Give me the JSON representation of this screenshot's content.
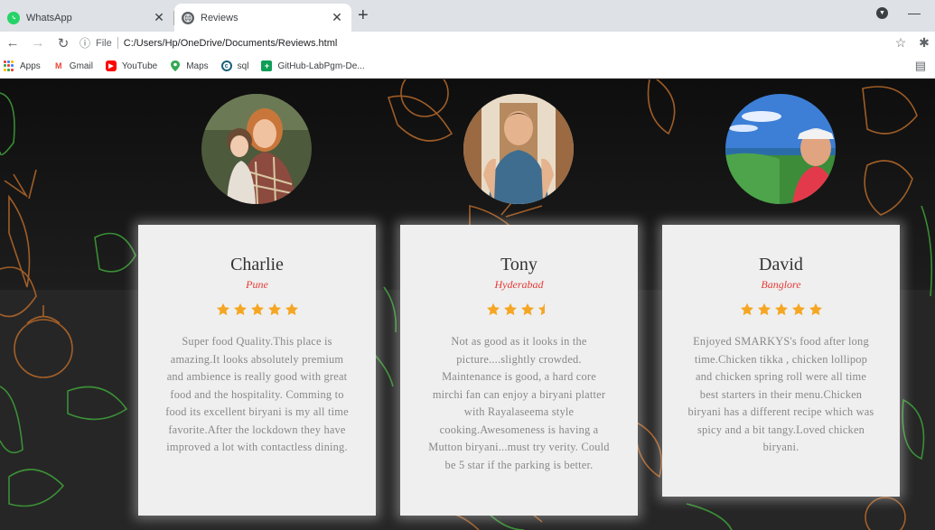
{
  "browser": {
    "tabs": [
      {
        "title": "WhatsApp",
        "icon": "whatsapp-icon",
        "active": false
      },
      {
        "title": "Reviews",
        "icon": "globe-icon",
        "active": true
      }
    ],
    "address": {
      "scheme_label": "File",
      "url": "C:/Users/Hp/OneDrive/Documents/Reviews.html"
    },
    "bookmarks": [
      {
        "label": "Apps",
        "icon": "apps-grid-icon"
      },
      {
        "label": "Gmail",
        "icon": "gmail-icon"
      },
      {
        "label": "YouTube",
        "icon": "youtube-icon"
      },
      {
        "label": "Maps",
        "icon": "maps-pin-icon"
      },
      {
        "label": "sql",
        "icon": "sql-icon"
      },
      {
        "label": "GitHub-LabPgm-De...",
        "icon": "github-labpgm-icon"
      }
    ]
  },
  "reviews": [
    {
      "name": "Charlie",
      "city": "Pune",
      "rating": 5,
      "text": "Super food Quality.This place is amazing.It looks absolutely premium and ambience is really good with great food and the hospitality. Comming to food its excellent biryani is my all time favorite.After the lockdown they have improved a lot with contactless dining."
    },
    {
      "name": "Tony",
      "city": "Hyderabad",
      "rating": 3.5,
      "text": "Not as good as it looks in the picture....slightly crowded. Maintenance is good, a hard core mirchi fan can enjoy a biryani platter with Rayalaseema style cooking.Awesomeness is having a Mutton biryani...must try verity. Could be 5 star if the parking is better."
    },
    {
      "name": "David",
      "city": "Banglore",
      "rating": 5,
      "text": "Enjoyed SMARKYS's food after long time.Chicken tikka , chicken lollipop and chicken spring roll were all time best starters in their menu.Chicken biryani has a different recipe which was spicy and a bit tangy.Loved chicken biryani."
    }
  ],
  "colors": {
    "star": "#f5a623",
    "city": "#e53935",
    "card_bg": "#efefef",
    "review_text": "#888888",
    "sketch_orange": "#b86a2a",
    "sketch_green": "#3fa23a"
  }
}
